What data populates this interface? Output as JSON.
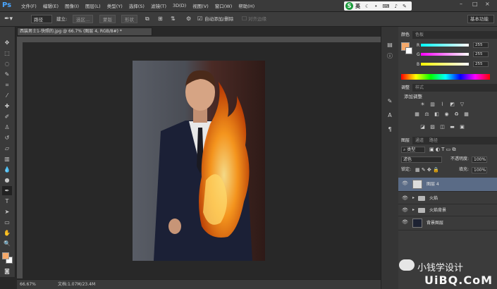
{
  "menubar": {
    "logo": "Ps",
    "items": [
      "文件(F)",
      "编辑(E)",
      "图像(I)",
      "图层(L)",
      "类型(Y)",
      "选择(S)",
      "滤镜(T)",
      "3D(D)",
      "视图(V)",
      "窗口(W)",
      "帮助(H)"
    ],
    "ime": {
      "logo": "S",
      "mode": "英",
      "icons": [
        "moon-icon",
        "dot-icon",
        "keyboard-icon",
        "mic-icon",
        "wrench-icon"
      ]
    },
    "window_controls": [
      "–",
      "□",
      "×"
    ]
  },
  "optbar": {
    "mode": "路径",
    "make_label": "建立:",
    "make_selection": "选区...",
    "mask_button": "蒙版",
    "shape_button": "形状",
    "auto_add_delete": "自动添加/删除",
    "align_edges": "对齐边缘",
    "workspace": "基本功能"
  },
  "document": {
    "tab_title": "西装男士1-快照的.jpg @ 66.7% (图层 4, RGB/8#) *",
    "zoom": "66.67%",
    "doc_info": "文档:1.07M/23.4M"
  },
  "panels": {
    "color": {
      "tabs": [
        "颜色",
        "色板"
      ],
      "fg_color": "#f5a96a",
      "rows": [
        {
          "label": "R",
          "value": "255",
          "bar": "linear-gradient(90deg,#00ffff,#ffffff)"
        },
        {
          "label": "G",
          "value": "255",
          "bar": "linear-gradient(90deg,#ff00ff,#ffffff)"
        },
        {
          "label": "B",
          "value": "255",
          "bar": "linear-gradient(90deg,#ffff00,#ffffff)"
        }
      ]
    },
    "adjustments": {
      "tabs": [
        "调整",
        "样式"
      ],
      "title": "添加调整"
    },
    "layers": {
      "tabs": [
        "图层",
        "通道",
        "路径"
      ],
      "filter": "类型",
      "blend_mode": "滤色",
      "opacity_label": "不透明度:",
      "opacity": "100%",
      "lock_label": "锁定:",
      "fill_label": "填充:",
      "fill": "100%",
      "items": [
        {
          "name": "图层 4",
          "selected": true,
          "type": "layer"
        },
        {
          "name": "火焰",
          "selected": false,
          "type": "group"
        },
        {
          "name": "火焰背景",
          "selected": false,
          "type": "group"
        },
        {
          "name": "背景图层",
          "selected": false,
          "type": "image"
        }
      ]
    }
  },
  "watermark": {
    "name": "小钱学设计",
    "url": "UiBQ.CoM"
  }
}
